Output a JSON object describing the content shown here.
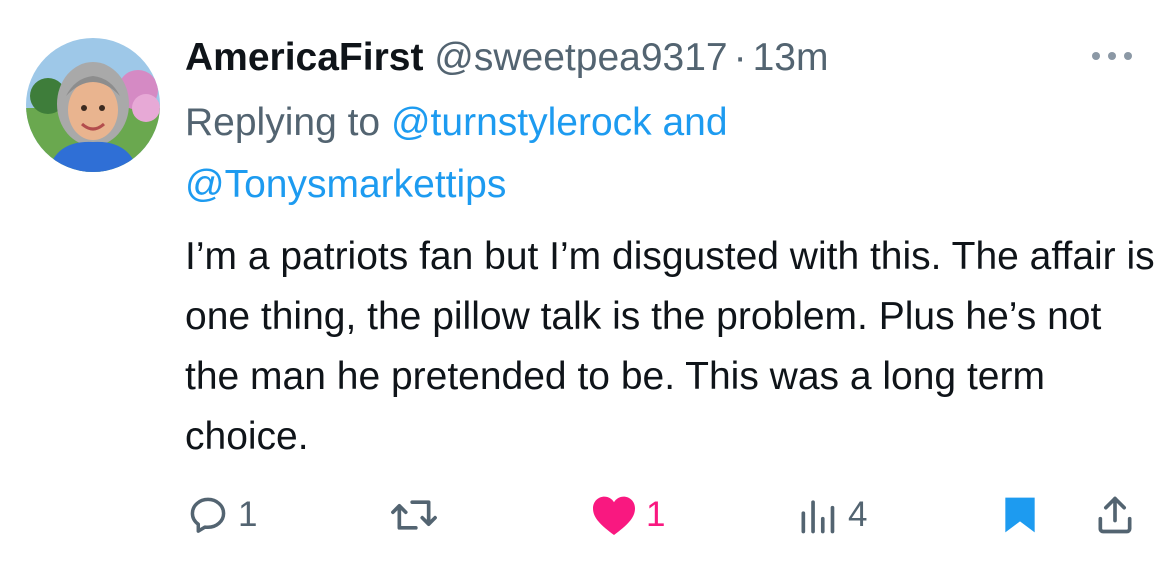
{
  "tweet": {
    "display_name": "AmericaFirst",
    "handle": "@sweetpea9317",
    "separator": "·",
    "time": "13m",
    "replying_prefix": "Replying to",
    "mention_1": "@turnstylerock",
    "mention_joiner": "and",
    "mention_2": "@Tonysmarkettips",
    "text": "I’m a patriots fan but I’m disgusted with this. The affair is one thing, the pillow talk is the problem. Plus he’s not the man he pretended to be. This was a long term choice."
  },
  "actions": {
    "reply": {
      "icon": "reply-icon",
      "count": "1"
    },
    "retweet": {
      "icon": "retweet-icon",
      "count": ""
    },
    "like": {
      "icon": "heart-filled-icon",
      "count": "1",
      "liked": true
    },
    "views": {
      "icon": "bar-chart-icon",
      "count": "4"
    },
    "bookmark": {
      "icon": "bookmark-filled-icon",
      "bookmarked": true
    },
    "share": {
      "icon": "share-icon"
    }
  },
  "colors": {
    "text": "#0f1419",
    "secondary": "#536471",
    "link": "#1d9bf0",
    "like": "#f91880",
    "bookmark": "#1d9bf0"
  }
}
